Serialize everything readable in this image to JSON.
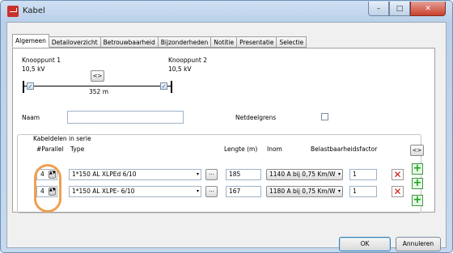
{
  "window": {
    "title": "Kabel"
  },
  "tabs": [
    {
      "label": "Algemeen"
    },
    {
      "label": "Detailoverzicht"
    },
    {
      "label": "Betrouwbaarheid"
    },
    {
      "label": "Bijzonderheden"
    },
    {
      "label": "Notitie"
    },
    {
      "label": "Presentatie"
    },
    {
      "label": "Selectie"
    }
  ],
  "nodes": {
    "node1_label": "Knooppunt 1",
    "node1_voltage": "10,5 kV",
    "node2_label": "Knooppunt 2",
    "node2_voltage": "10,5 kV",
    "swap_label": "<>",
    "length_label": "352 m"
  },
  "fields": {
    "name_label": "Naam",
    "name_value": "",
    "netdeelgrens_label": "Netdeelgrens"
  },
  "cable_parts": {
    "group_title": "Kabeldelen in serie",
    "headers": {
      "parallel": "#Parallel",
      "type": "Type",
      "length": "Lengte (m)",
      "inom": "Inom",
      "load_factor": "Belastbaarheidsfactor"
    },
    "swap_label": "<>",
    "rows": [
      {
        "parallel": "4",
        "type": "1*150 AL XLPEd  6/10",
        "dots": "...",
        "length": "185",
        "inom": "1140 A bij 0,75 Km/W",
        "factor": "1"
      },
      {
        "parallel": "4",
        "type": "1*150 AL XLPE-  6/10",
        "dots": "...",
        "length": "167",
        "inom": "1180 A bij 0,75 Km/W",
        "factor": "1"
      }
    ]
  },
  "buttons": {
    "ok": "OK",
    "cancel": "Annuleren"
  },
  "icons": {
    "dropdown": "▾",
    "delete": "✕",
    "add": "+",
    "spin": "▲▼",
    "check": "✓"
  }
}
